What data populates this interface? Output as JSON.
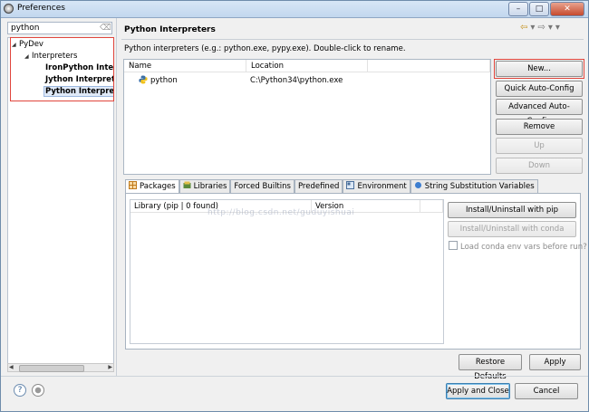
{
  "window": {
    "title": "Preferences",
    "minimize": "–",
    "maximize": "□",
    "close": "✕"
  },
  "sidebar": {
    "filter_value": "python",
    "tree": [
      {
        "label": "PyDev",
        "level": 0,
        "expanded": true
      },
      {
        "label": "Interpreters",
        "level": 1,
        "expanded": true
      },
      {
        "label": "IronPython Interp",
        "level": 2
      },
      {
        "label": "Jython Interprete",
        "level": 2
      },
      {
        "label": "Python Interprete",
        "level": 2,
        "selected": true
      }
    ]
  },
  "page": {
    "title": "Python Interpreters",
    "description": "Python interpreters (e.g.: python.exe, pypy.exe).   Double-click to rename.",
    "columns": [
      "Name",
      "Location"
    ],
    "rows": [
      {
        "name": "python",
        "location": "C:\\Python34\\python.exe"
      }
    ],
    "side_buttons": {
      "new": "New...",
      "quick": "Quick Auto-Config",
      "advanced": "Advanced Auto-Config",
      "remove": "Remove",
      "up": "Up",
      "down": "Down"
    }
  },
  "tabs": [
    "Packages",
    "Libraries",
    "Forced Builtins",
    "Predefined",
    "Environment",
    "String Substitution Variables"
  ],
  "packages": {
    "columns": [
      "Library (pip | 0 found)",
      "Version"
    ],
    "install_pip": "Install/Uninstall with pip",
    "install_conda": "Install/Uninstall with conda",
    "load_conda": "Load conda env vars before run?"
  },
  "watermark": "http://blog.csdn.net/guduyishuai",
  "footer": {
    "restore_defaults": "Restore Defaults",
    "apply": "Apply",
    "apply_close": "Apply and Close",
    "cancel": "Cancel",
    "help_glyph": "?"
  },
  "colors": {
    "highlight_red": "#e0453c",
    "selection": "#dfe9f7",
    "python_icon_blue": "#3b6fa5",
    "python_icon_yellow": "#f2c21a"
  },
  "icons": [
    "preferences-icon",
    "clear-filter-icon",
    "back-icon",
    "forward-icon",
    "view-menu-icon",
    "python-icon",
    "packages-icon",
    "libraries-icon",
    "environment-icon",
    "string-substitution-icon",
    "help-icon",
    "record-macro-icon"
  ]
}
